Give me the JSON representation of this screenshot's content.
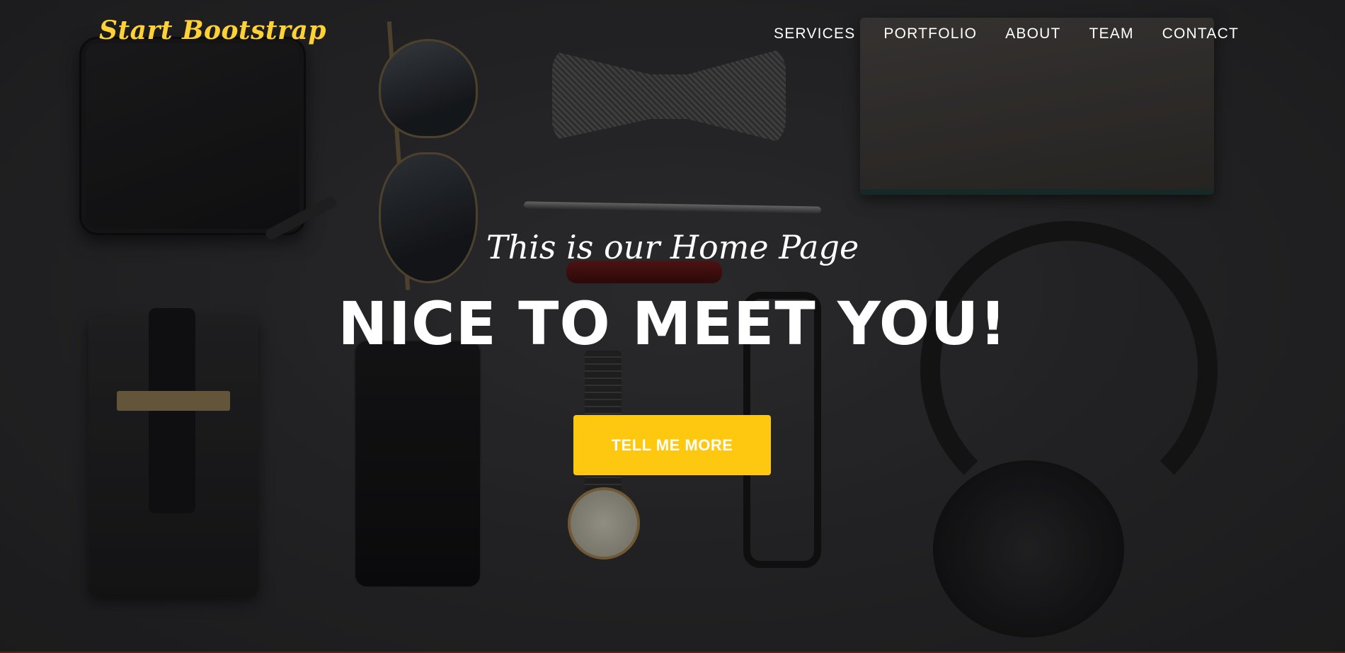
{
  "navbar": {
    "brand": "Start Bootstrap",
    "links": [
      "SERVICES",
      "PORTFOLIO",
      "ABOUT",
      "TEAM",
      "CONTACT"
    ]
  },
  "hero": {
    "subheading": "This is our Home Page",
    "heading": "NICE TO MEET YOU!",
    "button_label": "TELL ME MORE",
    "background_image": "flat-lay-accessories"
  },
  "colors": {
    "accent": "#fec810",
    "brand": "#fed136",
    "text": "#ffffff",
    "background": "#303033"
  }
}
